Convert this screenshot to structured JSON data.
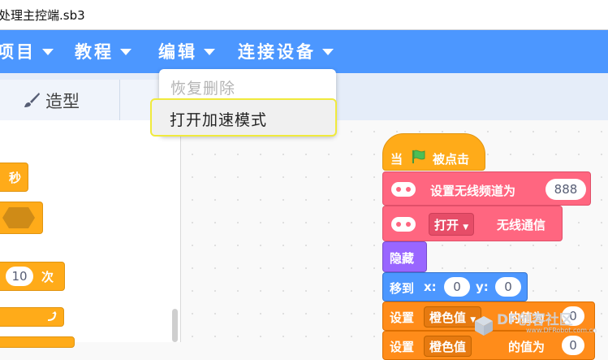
{
  "window": {
    "title": "处理主控端.sb3"
  },
  "menubar": {
    "items": [
      {
        "label": "项目"
      },
      {
        "label": "教程"
      },
      {
        "label": "编辑"
      },
      {
        "label": "连接设备"
      }
    ]
  },
  "edit_menu": {
    "items": [
      {
        "label": "恢复删除",
        "enabled": false
      },
      {
        "label": "打开加速模式",
        "enabled": true,
        "highlighted": true
      }
    ]
  },
  "tabs": [
    {
      "label": "造型",
      "icon": "brush-icon"
    }
  ],
  "palette": {
    "blocks": [
      {
        "text": "秒",
        "category": "control"
      },
      {
        "text": "",
        "category": "control-hexagon"
      },
      {
        "value": "10",
        "text": "次",
        "category": "control"
      },
      {
        "text": "",
        "category": "control"
      }
    ]
  },
  "script": {
    "hat": {
      "prefix": "当",
      "suffix": "被点击",
      "icon": "green-flag-icon"
    },
    "set_channel": {
      "label": "设置无线频道为",
      "value": "888"
    },
    "radio": {
      "dropdown": "打开",
      "label": "无线通信"
    },
    "hide": {
      "label": "隐藏"
    },
    "goto": {
      "label": "移到",
      "x_label": "x:",
      "x_value": "0",
      "y_label": "y:",
      "y_value": "0"
    },
    "set_effect": {
      "label": "设置",
      "dropdown": "橙色值",
      "suffix": "的值为",
      "value": "0"
    },
    "set_effect2": {
      "label": "设置",
      "dropdown": "橙色值",
      "suffix": "的值为",
      "value": "0"
    }
  },
  "watermark": {
    "text": "DF创客社区",
    "url": "www.DFRobot.com.cn"
  },
  "colors": {
    "menubar": "#4c97ff",
    "control": "#ffab19",
    "radio": "#ff6680",
    "looks": "#9966ff",
    "motion": "#4c97ff",
    "highlight_border": "#f0ea3c"
  }
}
